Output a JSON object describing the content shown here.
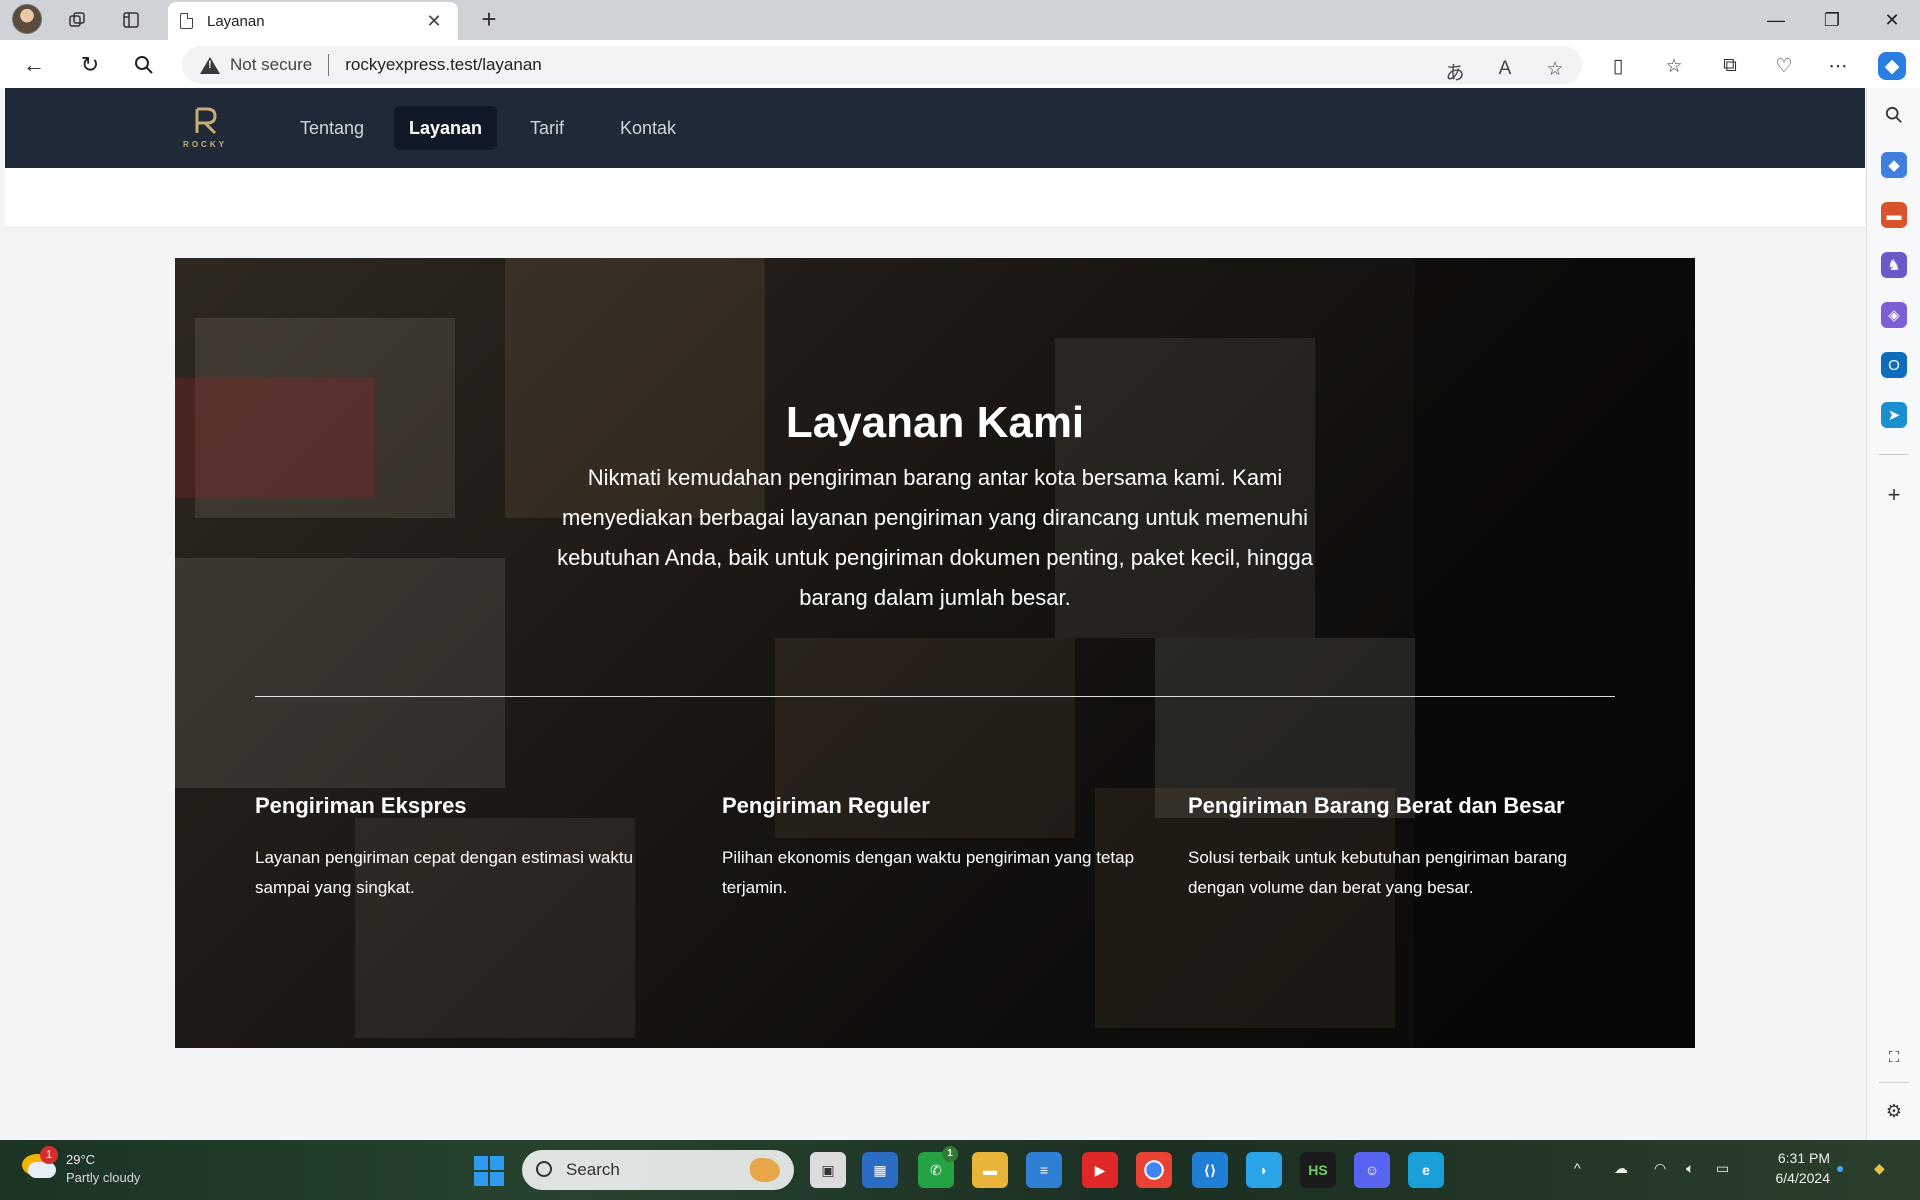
{
  "browser": {
    "tab": {
      "title": "Layanan"
    },
    "address": {
      "security": "Not secure",
      "url": "rockyexpress.test/layanan"
    }
  },
  "site": {
    "logo_text": "ROCKY",
    "nav": [
      {
        "label": "Tentang",
        "active": false
      },
      {
        "label": "Layanan",
        "active": true
      },
      {
        "label": "Tarif",
        "active": false
      },
      {
        "label": "Kontak",
        "active": false
      }
    ]
  },
  "hero": {
    "title": "Layanan Kami",
    "description": "Nikmati kemudahan pengiriman barang antar kota bersama kami. Kami menyediakan berbagai layanan pengiriman yang dirancang untuk memenuhi kebutuhan Anda, baik untuk pengiriman dokumen penting, paket kecil, hingga barang dalam jumlah besar."
  },
  "services": [
    {
      "title": "Pengiriman Ekspres",
      "description": "Layanan pengiriman cepat dengan estimasi waktu sampai yang singkat."
    },
    {
      "title": "Pengiriman Reguler",
      "description": "Pilihan ekonomis dengan waktu pengiriman yang tetap terjamin."
    },
    {
      "title": "Pengiriman Barang Berat dan Besar",
      "description": "Solusi terbaik untuk kebutuhan pengiriman barang dengan volume dan berat yang besar."
    }
  ],
  "taskbar": {
    "weather": {
      "temp": "29°C",
      "condition": "Partly cloudy",
      "badge": "1"
    },
    "search_placeholder": "Search",
    "whatsapp_badge": "1",
    "clock": {
      "time": "6:31 PM",
      "date": "6/4/2024"
    }
  },
  "colors": {
    "nav_bg": "#1f2937",
    "nav_active_bg": "#111827",
    "accent_logo": "#c9ad75"
  }
}
